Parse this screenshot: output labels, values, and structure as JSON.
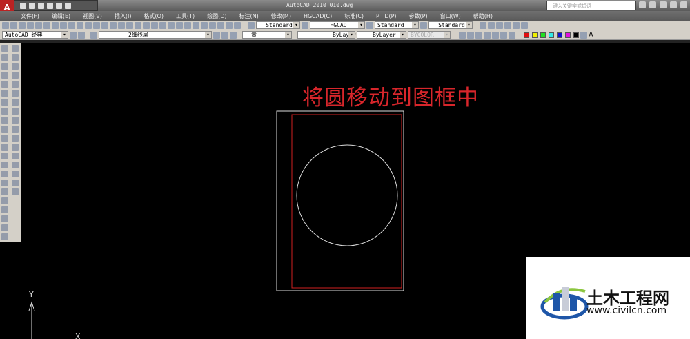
{
  "title": {
    "app": "AutoCAD 2010   010.dwg",
    "search_placeholder": "键入关键字或短语",
    "logo": "A"
  },
  "menu": [
    "文件(F)",
    "编辑(E)",
    "视图(V)",
    "插入(I)",
    "格式(O)",
    "工具(T)",
    "绘图(D)",
    "标注(N)",
    "修改(M)",
    "HGCAD(C)",
    "标准(C)",
    "P I D(P)",
    "参数(P)",
    "窗口(W)",
    "帮助(H)"
  ],
  "toolbar1": {
    "text_style": "Standard",
    "dim_style": "HGCAD",
    "table_style": "Standard",
    "multileader_style": "Standard"
  },
  "toolbar2": {
    "workspace": "AutoCAD 经典",
    "layer": "2细线层",
    "color": "黄",
    "linetype": "ByLayer",
    "lineweight": "ByLayer",
    "plotstyle": "BYCOLOR",
    "text_icon": "A"
  },
  "palette": [
    "#e01010",
    "#f0f000",
    "#20e020",
    "#30e8e8",
    "#1010d0",
    "#e010e0",
    "#000000"
  ],
  "drawing": {
    "annotation": "将圆移动到图框中",
    "ucs_y": "Y",
    "ucs_x": "X"
  },
  "watermark": {
    "name": "土木工程网",
    "url": "www.civilcn.com"
  }
}
